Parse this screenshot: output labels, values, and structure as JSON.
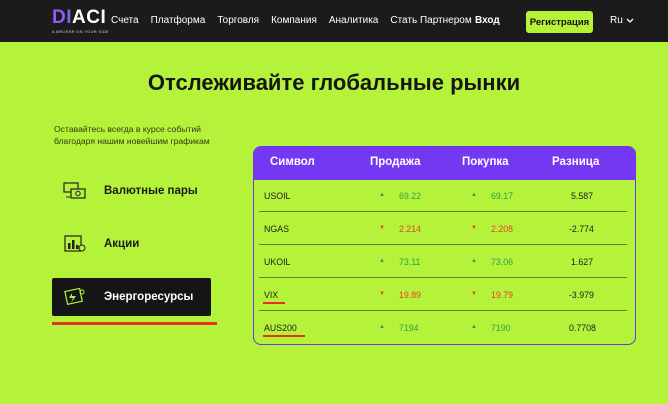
{
  "nav": {
    "logo_main_d": "DI",
    "logo_main_rest": "ACI",
    "logo_sub": "A BROKER ON YOUR SIDE",
    "menu": [
      "Счета",
      "Платформа",
      "Торговля",
      "Компания",
      "Аналитика",
      "Стать Партнером"
    ],
    "login": "Вход",
    "register": "Регистрация",
    "lang": "Ru",
    "colors": {
      "bar": "#1b1b1b",
      "accent": "#b5f23a",
      "logo_d": "#8f5cf6"
    }
  },
  "hero": {
    "headline": "Отслеживайте глобальные рынки",
    "subtext": "Оставайтесь всегда в курсе событий благодаря нашим новейшим графикам"
  },
  "categories": [
    {
      "label": "Валютные пары",
      "icon": "currency-pairs-icon",
      "active": false
    },
    {
      "label": "Акции",
      "icon": "stocks-icon",
      "active": false
    },
    {
      "label": "Энергоресурсы",
      "icon": "energy-icon",
      "active": true
    }
  ],
  "table": {
    "headers": [
      "Символ",
      "Продажа",
      "Покупка",
      "Разница"
    ],
    "header_color": "#7437f2",
    "rows": [
      {
        "symbol": "USOIL",
        "sell": "69.22",
        "sell_dir": "up",
        "buy": "69.17",
        "buy_dir": "up",
        "diff": "5.587"
      },
      {
        "symbol": "NGAS",
        "sell": "2.214",
        "sell_dir": "down",
        "buy": "2.208",
        "buy_dir": "down",
        "diff": "-2.774"
      },
      {
        "symbol": "UKOIL",
        "sell": "73.11",
        "sell_dir": "up",
        "buy": "73.06",
        "buy_dir": "up",
        "diff": "1.627"
      },
      {
        "symbol": "VIX",
        "sell": "19.89",
        "sell_dir": "down",
        "buy": "19.79",
        "buy_dir": "down",
        "diff": "-3.979"
      },
      {
        "symbol": "AUS200",
        "sell": "7194",
        "sell_dir": "up",
        "buy": "7190",
        "buy_dir": "up",
        "diff": "0.7708"
      }
    ],
    "up_color": "#2f9d56",
    "down_color": "#e8442a"
  }
}
